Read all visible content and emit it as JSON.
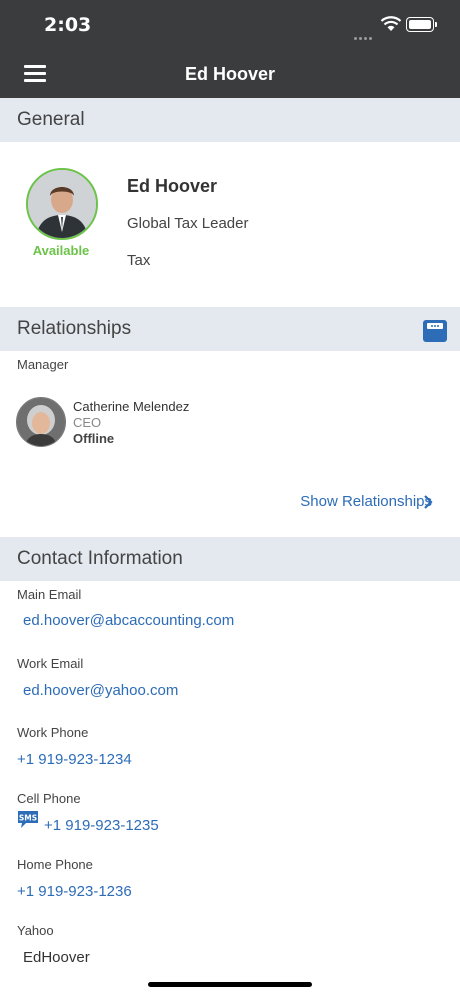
{
  "status": {
    "time": "2:03"
  },
  "navbar": {
    "title": "Ed Hoover"
  },
  "general": {
    "header": "General",
    "name": "Ed Hoover",
    "job_title": "Global Tax Leader",
    "department": "Tax",
    "availability": "Available"
  },
  "relationships": {
    "header": "Relationships",
    "manager_label": "Manager",
    "manager": {
      "name": "Catherine Melendez",
      "role": "CEO",
      "status": "Offline"
    },
    "show_link": "Show Relationships"
  },
  "contact": {
    "header": "Contact Information",
    "main_email_label": "Main Email",
    "main_email": "ed.hoover@abcaccounting.com",
    "work_email_label": "Work Email",
    "work_email": "ed.hoover@yahoo.com",
    "work_phone_label": "Work Phone",
    "work_phone": "+1 919-923-1234",
    "cell_phone_label": "Cell Phone",
    "sms_icon_text": "SMS",
    "cell_phone": "+1 919-923-1235",
    "home_phone_label": "Home Phone",
    "home_phone": "+1 919-923-1236",
    "yahoo_label": "Yahoo",
    "yahoo": "EdHoover"
  },
  "colors": {
    "bar": "#3a3c3e",
    "section": "#e4e9f0",
    "link": "#2d6cb7",
    "available": "#6cc34a"
  },
  "icons": [
    "menu-icon",
    "save-icon",
    "chevron-right-icon",
    "sms-icon",
    "wifi-icon",
    "battery-icon"
  ]
}
